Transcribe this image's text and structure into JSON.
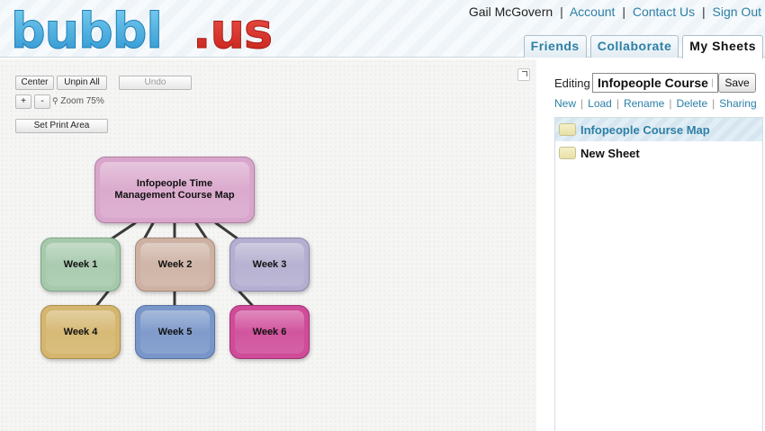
{
  "header": {
    "logo_text": "bubbl.us",
    "user_name": "Gail McGovern",
    "links": [
      "Account",
      "Contact Us",
      "Sign Out"
    ],
    "tabs": [
      "Friends",
      "Collaborate",
      "My Sheets"
    ],
    "active_tab": "My Sheets"
  },
  "toolbar": {
    "center_label": "Center",
    "unpin_all_label": "Unpin All",
    "undo_label": "Undo",
    "zoom_in_label": "+",
    "zoom_out_label": "-",
    "zoom_text": "Zoom 75%",
    "set_print_area_label": "Set Print Area"
  },
  "mindmap": {
    "root": {
      "label_line1": "Infopeople Time",
      "label_line2": "Management Course Map",
      "color": "#d9a6cb"
    },
    "weeks": [
      {
        "label": "Week 1",
        "color": "#a6c9ac"
      },
      {
        "label": "Week 2",
        "color": "#cdb1a3"
      },
      {
        "label": "Week 3",
        "color": "#b4aed0"
      },
      {
        "label": "Week 4",
        "color": "#d4b66e"
      },
      {
        "label": "Week 5",
        "color": "#7996c9"
      },
      {
        "label": "Week 6",
        "color": "#cf4c99"
      }
    ]
  },
  "panel": {
    "editing_label": "Editing",
    "sheet_name_value": "Infopeople Course Map",
    "save_label": "Save",
    "actions": [
      "New",
      "Load",
      "Rename",
      "Delete",
      "Sharing"
    ],
    "sheets": [
      {
        "name": "Infopeople Course Map",
        "selected": true
      },
      {
        "name": "New Sheet",
        "selected": false
      }
    ]
  },
  "colors": {
    "accent": "#2d7fa6",
    "logo_blue": "#3aa3d8",
    "logo_red": "#d8281f"
  }
}
